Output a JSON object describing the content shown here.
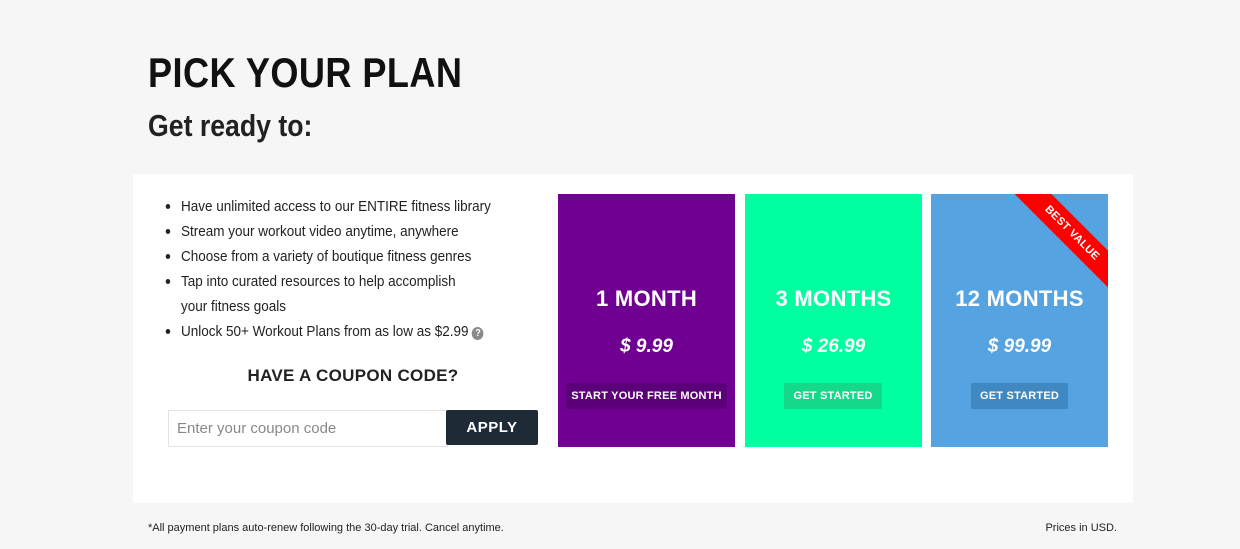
{
  "header": {
    "title": "PICK YOUR PLAN",
    "subtitle": "Get ready to:"
  },
  "features": [
    "Have unlimited access to our ENTIRE fitness library",
    "Stream your workout video anytime, anywhere",
    "Choose from a variety of boutique fitness genres",
    "Tap into curated resources to help accomplish your fitness goals",
    "Unlock 50+ Workout Plans from as low as $2.99"
  ],
  "coupon": {
    "heading": "HAVE A COUPON CODE?",
    "placeholder": "Enter your coupon code",
    "value": "",
    "apply_label": "APPLY"
  },
  "plans": [
    {
      "name": "1 MONTH",
      "price": "$ 9.99",
      "button_label": "START YOUR FREE MONTH",
      "bg": "#6f0092",
      "button_bg": "#5b0078"
    },
    {
      "name": "3 MONTHS",
      "price": "$ 26.99",
      "button_label": "GET STARTED",
      "bg": "#00ff9f",
      "button_bg": "#14d98a"
    },
    {
      "name": "12 MONTHS",
      "price": "$ 99.99",
      "button_label": "GET STARTED",
      "bg": "#55a3e0",
      "button_bg": "#3f88c2",
      "badge": "BEST VALUE",
      "badge_bg": "#ff0000"
    }
  ],
  "footer": {
    "note": "*All payment plans auto-renew following the 30-day trial. Cancel anytime.",
    "currency": "Prices in USD."
  },
  "icons": {
    "help": "question-circle-icon"
  }
}
